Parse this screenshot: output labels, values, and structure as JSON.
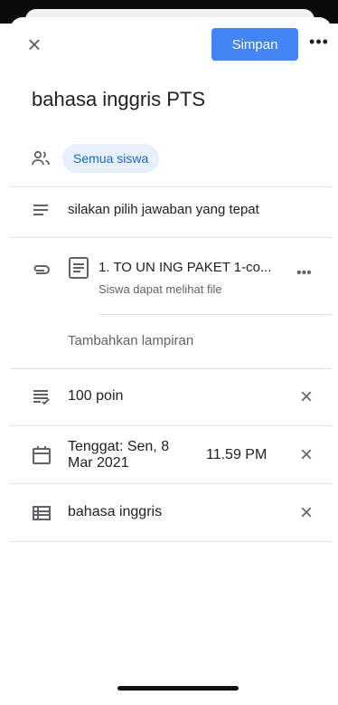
{
  "header": {
    "save_label": "Simpan",
    "close_icon": "×",
    "more_icon": "•••"
  },
  "title": "bahasa inggris PTS",
  "audience": {
    "chip": "Semua siswa"
  },
  "instructions": {
    "text": "silakan pilih jawaban yang tepat"
  },
  "attachment": {
    "name": "1. TO UN ING PAKET 1-co...",
    "subtitle": "Siswa dapat melihat file",
    "add_label": "Tambahkan lampiran"
  },
  "points": {
    "text": "100 poin"
  },
  "due": {
    "label": "Tenggat: Sen, 8 Mar 2021",
    "time": "11.59 PM"
  },
  "topic": {
    "text": "bahasa inggris"
  },
  "colors": {
    "accent": "#4285f4",
    "chip_bg": "#e8f0fe",
    "chip_text": "#1967d2"
  }
}
